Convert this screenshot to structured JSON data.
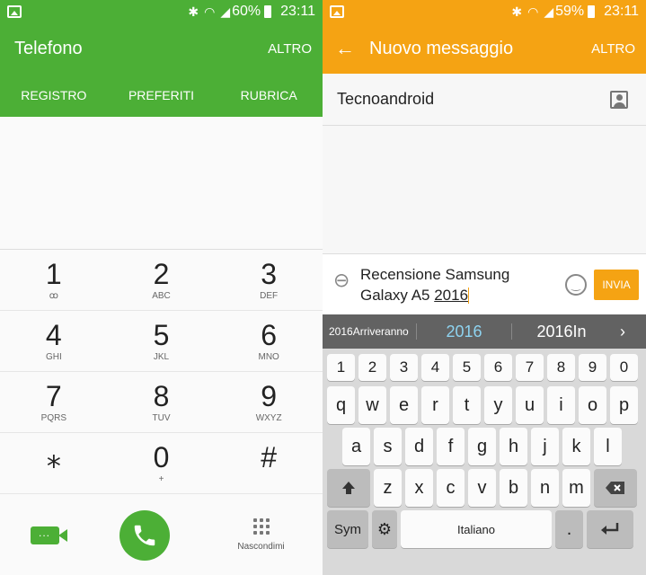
{
  "left": {
    "status": {
      "battery": "60%",
      "time": "23:11"
    },
    "title": "Telefono",
    "more": "ALTRO",
    "tabs": [
      "REGISTRO",
      "PREFERITI",
      "RUBRICA"
    ],
    "keys": [
      {
        "num": "1",
        "sub": "ꝏ"
      },
      {
        "num": "2",
        "sub": "ABC"
      },
      {
        "num": "3",
        "sub": "DEF"
      },
      {
        "num": "4",
        "sub": "GHI"
      },
      {
        "num": "5",
        "sub": "JKL"
      },
      {
        "num": "6",
        "sub": "MNO"
      },
      {
        "num": "7",
        "sub": "PQRS"
      },
      {
        "num": "8",
        "sub": "TUV"
      },
      {
        "num": "9",
        "sub": "WXYZ"
      },
      {
        "num": "⁎",
        "sub": ""
      },
      {
        "num": "0",
        "sub": "+"
      },
      {
        "num": "#",
        "sub": ""
      }
    ],
    "hide_label": "Nascondimi",
    "colors": {
      "accent": "#4caf36"
    }
  },
  "right": {
    "status": {
      "battery": "59%",
      "time": "23:11"
    },
    "title": "Nuovo messaggio",
    "more": "ALTRO",
    "recipient": "Tecnoandroid",
    "message_line1": "Recensione Samsung",
    "message_line2_prefix": "Galaxy A5 ",
    "message_line2_word": "2016",
    "send_label": "INVIA",
    "suggestions": [
      "2016Arriveranno",
      "2016",
      "2016In"
    ],
    "keyboard": {
      "numbers": [
        "1",
        "2",
        "3",
        "4",
        "5",
        "6",
        "7",
        "8",
        "9",
        "0"
      ],
      "row1": [
        "q",
        "w",
        "e",
        "r",
        "t",
        "y",
        "u",
        "i",
        "o",
        "p"
      ],
      "row2": [
        "a",
        "s",
        "d",
        "f",
        "g",
        "h",
        "j",
        "k",
        "l"
      ],
      "row3": [
        "z",
        "x",
        "c",
        "v",
        "b",
        "n",
        "m"
      ],
      "sym": "Sym",
      "space": "Italiano",
      "period": "."
    },
    "colors": {
      "accent": "#f5a313"
    }
  }
}
